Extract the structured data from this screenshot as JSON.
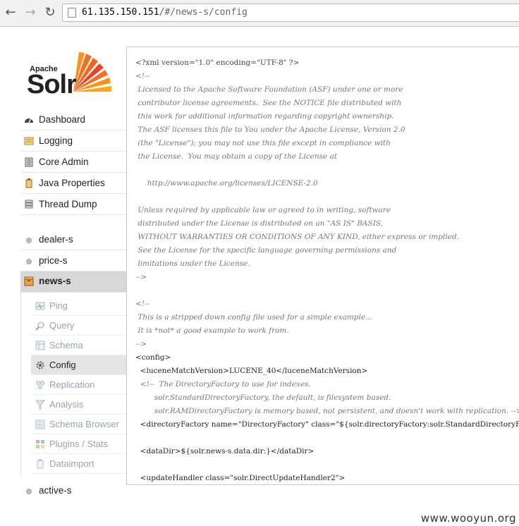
{
  "browser": {
    "url_host": "61.135.150.151",
    "url_path": "/#/news-s/config"
  },
  "logo": {
    "apache": "Apache",
    "solr": "Solr"
  },
  "sidebar": {
    "main": [
      {
        "label": "Dashboard"
      },
      {
        "label": "Logging"
      },
      {
        "label": "Core Admin"
      },
      {
        "label": "Java Properties"
      },
      {
        "label": "Thread Dump"
      }
    ],
    "cores": [
      {
        "label": "dealer-s"
      },
      {
        "label": "price-s"
      },
      {
        "label": "news-s"
      }
    ],
    "core_menu": [
      {
        "label": "Ping"
      },
      {
        "label": "Query"
      },
      {
        "label": "Schema"
      },
      {
        "label": "Config"
      },
      {
        "label": "Replication"
      },
      {
        "label": "Analysis"
      },
      {
        "label": "Schema Browser"
      },
      {
        "label": "Plugins / Stats"
      },
      {
        "label": "Dataimport"
      }
    ],
    "extra_core": {
      "label": "active-s"
    }
  },
  "config_lines": [
    "<?xml version=\"1.0\" encoding=\"UTF-8\" ?>",
    "<!--",
    " Licensed to the Apache Software Foundation (ASF) under one or more",
    " contributor license agreements.  See the NOTICE file distributed with",
    " this work for additional information regarding copyright ownership.",
    " The ASF licenses this file to You under the Apache License, Version 2.0",
    " (the \"License\"); you may not use this file except in compliance with",
    " the License.  You may obtain a copy of the License at",
    "",
    "     http://www.apache.org/licenses/LICENSE-2.0",
    "",
    " Unless required by applicable law or agreed to in writing, software",
    " distributed under the License is distributed on an \"AS IS\" BASIS,",
    " WITHOUT WARRANTIES OR CONDITIONS OF ANY KIND, either express or implied.",
    " See the License for the specific language governing permissions and",
    " limitations under the License.",
    "-->",
    "",
    "<!--",
    " This is a stripped down config file used for a simple example...",
    " It is *not* a good example to work from.",
    "-->",
    "<config>",
    "  <luceneMatchVersion>LUCENE_40</luceneMatchVersion>",
    "  <!--  The DirectoryFactory to use for indexes.",
    "        solr.StandardDirectoryFactory, the default, is filesystem based.",
    "        solr.RAMDirectoryFactory is memory based, not persistent, and doesn't work with replication. -->",
    "  <directoryFactory name=\"DirectoryFactory\" class=\"${solr.directoryFactory:solr.StandardDirectoryFactory}\"/>",
    "",
    "  <dataDir>${solr.news-s.data.dir:}</dataDir>",
    "",
    "  <updateHandler class=\"solr.DirectUpdateHandler2\">"
  ],
  "watermark": "www.wooyun.org"
}
